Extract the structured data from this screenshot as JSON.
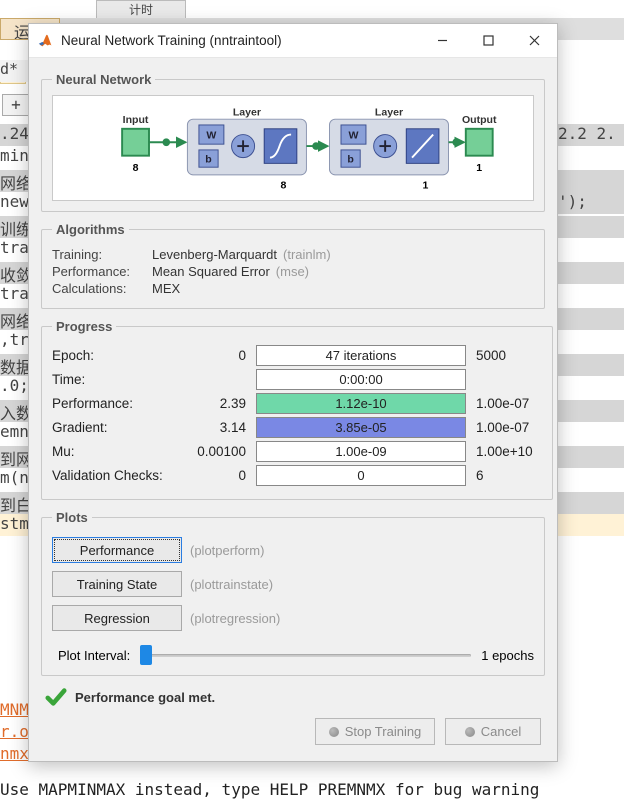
{
  "bg": {
    "top_tab": "计时",
    "run_btn": "运行",
    "lines": [
      "d*",
      "+",
      ".24",
      "min",
      "网络",
      "new",
      "训练",
      "tra",
      "收敛",
      "tra",
      "网络",
      ",tr",
      "数据",
      ".0;",
      "入数",
      "emn",
      "到网",
      "m(n",
      "到白",
      "stm",
      "",
      "MNMX",
      "r.o",
      "nmx"
    ],
    "right1": "2.2 2.",
    "right2": "');",
    "footer": "Use MAPMINMAX instead, type HELP PREMNMX for bug warning"
  },
  "window": {
    "title": "Neural Network Training (nntraintool)"
  },
  "net": {
    "legend": "Neural Network",
    "input": "Input",
    "output": "Output",
    "layer": "Layer",
    "w": "W",
    "b": "b",
    "in_size": "8",
    "h_size": "8",
    "out_size": "1"
  },
  "alg": {
    "legend": "Algorithms",
    "training_l": "Training:",
    "training_v": "Levenberg-Marquardt",
    "training_h": "(trainlm)",
    "perf_l": "Performance:",
    "perf_v": "Mean Squared Error",
    "perf_h": "(mse)",
    "calc_l": "Calculations:",
    "calc_v": "MEX"
  },
  "prog": {
    "legend": "Progress",
    "rows": {
      "epoch": {
        "label": "Epoch:",
        "start": "0",
        "text": "47 iterations",
        "end": "5000",
        "fill": 0
      },
      "time": {
        "label": "Time:",
        "start": "",
        "text": "0:00:00",
        "end": "",
        "fill": 0
      },
      "perf": {
        "label": "Performance:",
        "start": "2.39",
        "text": "1.12e-10",
        "end": "1.00e-07",
        "fill": 100,
        "color": "green"
      },
      "grad": {
        "label": "Gradient:",
        "start": "3.14",
        "text": "3.85e-05",
        "end": "1.00e-07",
        "fill": 100,
        "color": "blue"
      },
      "mu": {
        "label": "Mu:",
        "start": "0.00100",
        "text": "1.00e-09",
        "end": "1.00e+10",
        "fill": 0
      },
      "val": {
        "label": "Validation Checks:",
        "start": "0",
        "text": "0",
        "end": "6",
        "fill": 0
      }
    }
  },
  "plots": {
    "legend": "Plots",
    "perf_btn": "Performance",
    "perf_hint": "(plotperform)",
    "state_btn": "Training State",
    "state_hint": "(plottrainstate)",
    "reg_btn": "Regression",
    "reg_hint": "(plotregression)",
    "interval_l": "Plot Interval:",
    "interval_v": "1 epochs"
  },
  "status": "Performance goal met.",
  "buttons": {
    "stop": "Stop Training",
    "cancel": "Cancel"
  }
}
